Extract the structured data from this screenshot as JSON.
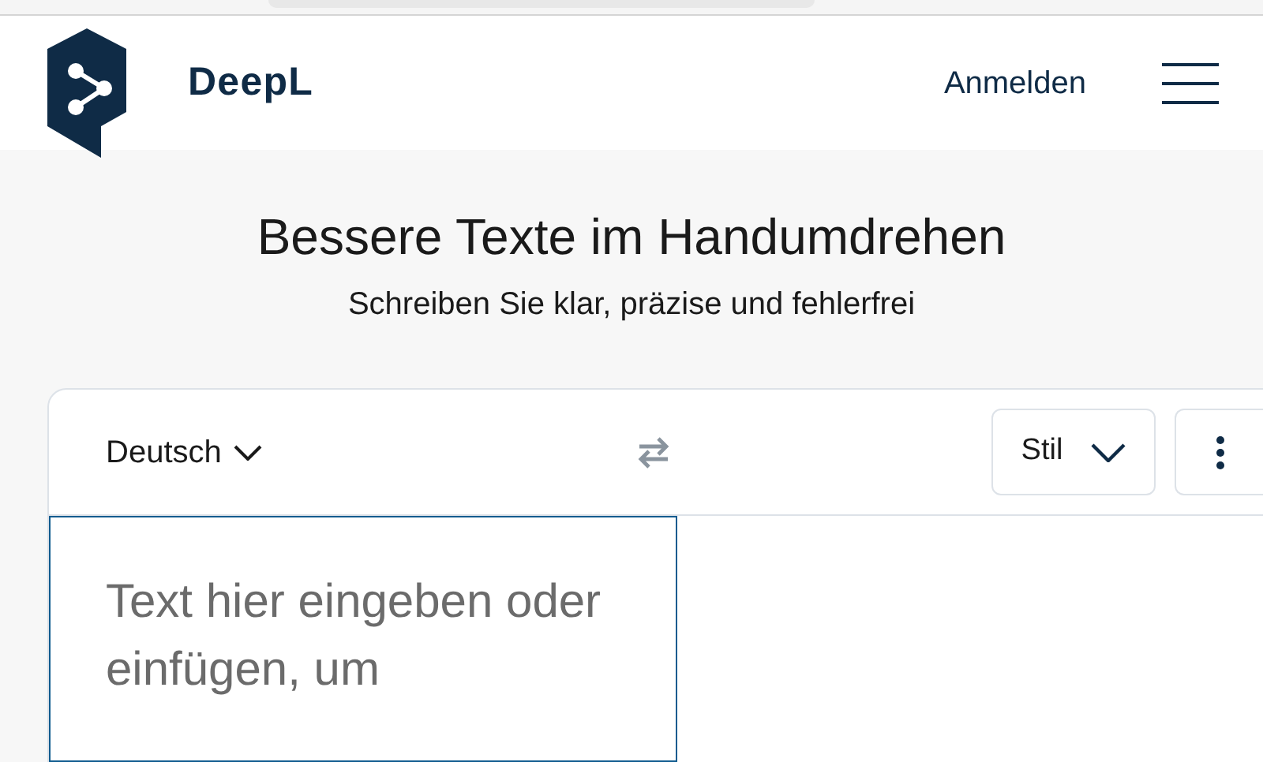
{
  "header": {
    "brand": "DeepL",
    "login": "Anmelden"
  },
  "hero": {
    "title": "Bessere Texte im Handumdrehen",
    "subtitle": "Schreiben Sie klar, präzise und fehlerfrei"
  },
  "toolbar": {
    "language": "Deutsch",
    "style": "Stil"
  },
  "editor": {
    "placeholder": "Text hier eingeben oder einfügen, um"
  }
}
